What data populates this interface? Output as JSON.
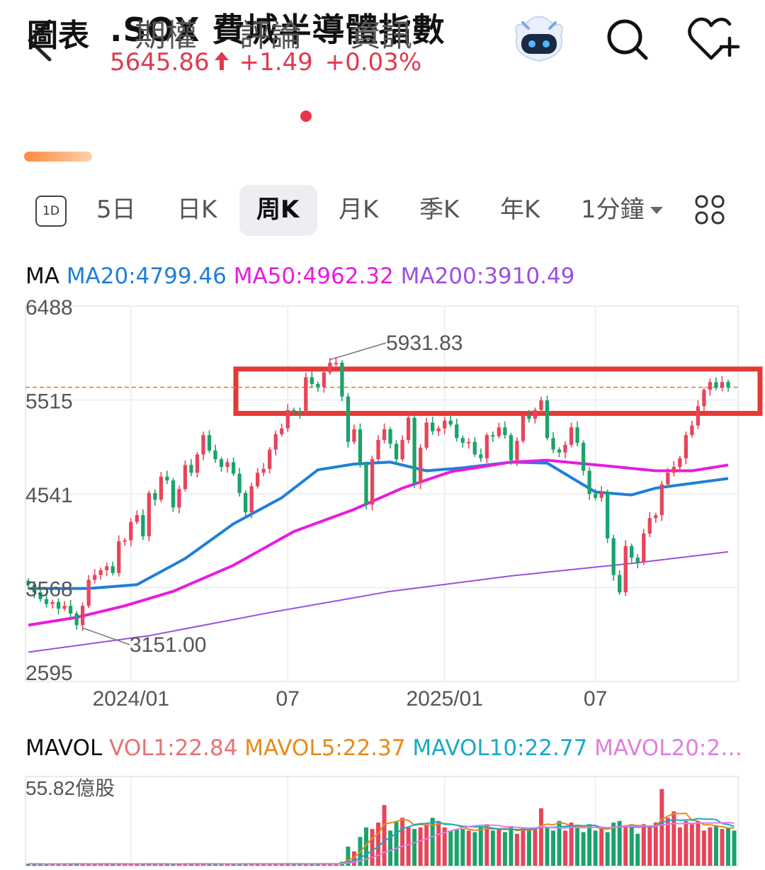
{
  "header": {
    "title": ".SOX  費城半導體指數",
    "price": "5645.86",
    "change": "+1.49",
    "change_pct": "+0.03%",
    "up_color": "#e03a4e"
  },
  "icons": {
    "back": "chevron-left-icon",
    "assistant": "robot-assistant-icon",
    "search": "search-icon",
    "watchlist": "heart-plus-icon",
    "layout": "grid-icon",
    "dropdown": "caret-down-icon"
  },
  "tabs": [
    {
      "label": "圖表",
      "active": true
    },
    {
      "label": "期權",
      "active": false
    },
    {
      "label": "評論",
      "active": false,
      "badge": true
    },
    {
      "label": "資訊",
      "active": false
    }
  ],
  "periods": {
    "one_day_icon": "1D",
    "items": [
      {
        "label": "5日",
        "active": false
      },
      {
        "label": "日K",
        "active": false
      },
      {
        "label": "周K",
        "active": true
      },
      {
        "label": "月K",
        "active": false
      },
      {
        "label": "季K",
        "active": false
      },
      {
        "label": "年K",
        "active": false
      },
      {
        "label": "1分鐘",
        "active": false
      }
    ]
  },
  "ma_legend": {
    "label": "MA",
    "ma20": "MA20:4799.46",
    "ma50": "MA50:4962.32",
    "ma200": "MA200:3910.49",
    "colors": {
      "ma20": "#1e7fd9",
      "ma50": "#e81be0",
      "ma200": "#9b4fe0"
    }
  },
  "vol_legend": {
    "label": "MAVOL",
    "vol1": "VOL1:22.84",
    "mavol5": "MAVOL5:22.37",
    "mavol10": "MAVOL10:22.77",
    "mavol20": "MAVOL20:2…",
    "max_label": "55.82億股",
    "colors": {
      "vol1": "#e87272",
      "mavol5": "#e88a1a",
      "mavol10": "#1ba7c9",
      "mavol20": "#e07ee0"
    }
  },
  "chart_data": {
    "type": "candlestick",
    "y_ticks": [
      "6488",
      "5515",
      "4541",
      "3568",
      "2595"
    ],
    "ylim": [
      2595,
      6488
    ],
    "x_ticks": [
      "2024/01",
      "07",
      "2025/01",
      "07"
    ],
    "current_price_line": 5645.86,
    "annotations": [
      {
        "text": "5931.83",
        "value": 5931.83,
        "kind": "high"
      },
      {
        "text": "3151.00",
        "value": 3151.0,
        "kind": "low"
      }
    ],
    "highlight_box": {
      "from": 5375,
      "to": 5835,
      "color": "#e53935"
    },
    "colors": {
      "up": "#e8455a",
      "down": "#1aa36b"
    },
    "closes": [
      3600,
      3520,
      3450,
      3400,
      3420,
      3350,
      3380,
      3300,
      3180,
      3380,
      3650,
      3700,
      3750,
      3790,
      3720,
      4050,
      4060,
      4250,
      4320,
      4100,
      4550,
      4480,
      4720,
      4680,
      4400,
      4590,
      4840,
      4760,
      4950,
      5150,
      4990,
      4900,
      4820,
      4870,
      4750,
      4550,
      4350,
      4620,
      4760,
      4800,
      5000,
      5160,
      5220,
      5410,
      5400,
      5380,
      5750,
      5680,
      5650,
      5800,
      5900,
      5900,
      5550,
      5080,
      5210,
      4850,
      4430,
      4900,
      5100,
      5210,
      5060,
      4900,
      5100,
      5330,
      4650,
      5020,
      5280,
      5190,
      5220,
      5300,
      5260,
      5120,
      5070,
      5080,
      4950,
      4910,
      5150,
      5140,
      5230,
      5150,
      4890,
      5090,
      5350,
      5320,
      5410,
      5510,
      5120,
      5000,
      4970,
      5050,
      5230,
      5070,
      4780,
      4540,
      4500,
      4560,
      4080,
      3700,
      3520,
      4000,
      3880,
      3830,
      4130,
      4290,
      4320,
      4640,
      4760,
      4820,
      4910,
      5150,
      5250,
      5450,
      5620,
      5700,
      5640,
      5700,
      5650
    ],
    "ma_lines": [
      {
        "name": "MA20",
        "points": [
          [
            0,
            3560
          ],
          [
            10,
            3560
          ],
          [
            18,
            3600
          ],
          [
            26,
            3870
          ],
          [
            34,
            4230
          ],
          [
            42,
            4500
          ],
          [
            48,
            4790
          ],
          [
            54,
            4850
          ],
          [
            60,
            4870
          ],
          [
            66,
            4780
          ],
          [
            72,
            4810
          ],
          [
            80,
            4870
          ],
          [
            86,
            4860
          ],
          [
            90,
            4710
          ],
          [
            94,
            4560
          ],
          [
            100,
            4530
          ],
          [
            104,
            4600
          ],
          [
            116,
            4700
          ]
        ]
      },
      {
        "name": "MA50",
        "points": [
          [
            0,
            3180
          ],
          [
            8,
            3260
          ],
          [
            16,
            3380
          ],
          [
            24,
            3530
          ],
          [
            34,
            3800
          ],
          [
            44,
            4150
          ],
          [
            54,
            4380
          ],
          [
            62,
            4600
          ],
          [
            70,
            4770
          ],
          [
            80,
            4870
          ],
          [
            86,
            4890
          ],
          [
            96,
            4830
          ],
          [
            104,
            4780
          ],
          [
            110,
            4780
          ],
          [
            116,
            4840
          ]
        ]
      },
      {
        "name": "MA200",
        "points": [
          [
            0,
            2900
          ],
          [
            20,
            3070
          ],
          [
            40,
            3310
          ],
          [
            60,
            3530
          ],
          [
            80,
            3690
          ],
          [
            100,
            3820
          ],
          [
            116,
            3940
          ]
        ]
      }
    ]
  },
  "volume_data": {
    "values": [
      1.2,
      1.1,
      1.2,
      1.0,
      1.2,
      1.1,
      1.3,
      1.0,
      1.1,
      1.2,
      1.2,
      1.1,
      1.3,
      1.2,
      1.1,
      1.2,
      1.0,
      1.1,
      1.2,
      1.3,
      1.1,
      1.2,
      1.0,
      1.1,
      1.2,
      1.1,
      1.2,
      1.3,
      1.1,
      1.2,
      1.1,
      1.2,
      1.0,
      1.1,
      1.2,
      1.1,
      1.3,
      1.2,
      1.1,
      1.2,
      1.1,
      1.2,
      1.3,
      1.1,
      1.2,
      1.1,
      1.2,
      1.1,
      1.3,
      1.2,
      1.1,
      1.2,
      2.5,
      12,
      9,
      18,
      24,
      23,
      27,
      38,
      22,
      28,
      30,
      24,
      23,
      24,
      26,
      30,
      28,
      24,
      22,
      23,
      23,
      22,
      21,
      24,
      26,
      22,
      23,
      21,
      24,
      20,
      24,
      22,
      24,
      36,
      24,
      22,
      28,
      22,
      27,
      24,
      21,
      26,
      22,
      24,
      21,
      27,
      28,
      25,
      26,
      20,
      26,
      24,
      27,
      48,
      30,
      34,
      24,
      28,
      26,
      28,
      22,
      24,
      25,
      23,
      24,
      22
    ],
    "max": 55.82
  }
}
